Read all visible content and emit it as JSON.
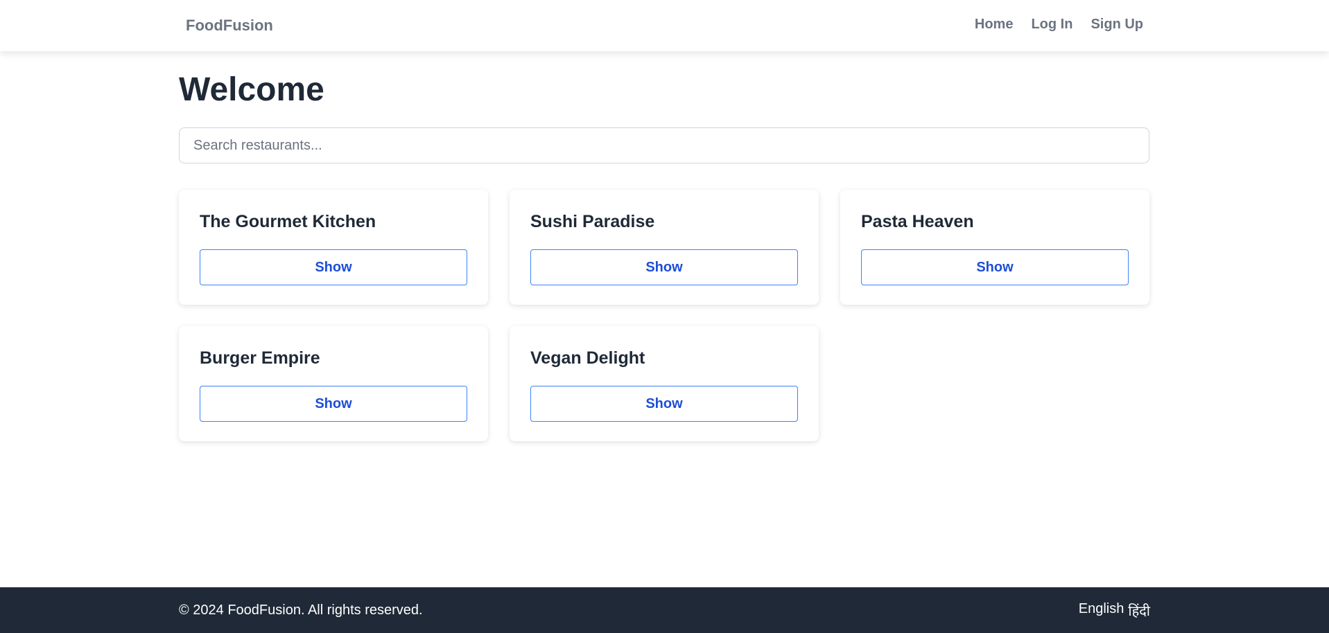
{
  "header": {
    "brand": "FoodFusion",
    "nav": [
      {
        "label": "Home"
      },
      {
        "label": "Log In"
      },
      {
        "label": "Sign Up"
      }
    ]
  },
  "main": {
    "title": "Welcome",
    "search_placeholder": "Search restaurants...",
    "restaurants": [
      {
        "name": "The Gourmet Kitchen",
        "button": "Show"
      },
      {
        "name": "Sushi Paradise",
        "button": "Show"
      },
      {
        "name": "Pasta Heaven",
        "button": "Show"
      },
      {
        "name": "Burger Empire",
        "button": "Show"
      },
      {
        "name": "Vegan Delight",
        "button": "Show"
      }
    ]
  },
  "footer": {
    "copyright": "© 2024 FoodFusion. All rights reserved.",
    "languages": [
      {
        "label": "English"
      },
      {
        "label": "हिंदी"
      }
    ]
  },
  "colors": {
    "nav_text": "#6b7280",
    "heading": "#1f2937",
    "button_border": "#3b82f6",
    "button_text": "#1d4ed8",
    "footer_bg": "#1f2937"
  }
}
